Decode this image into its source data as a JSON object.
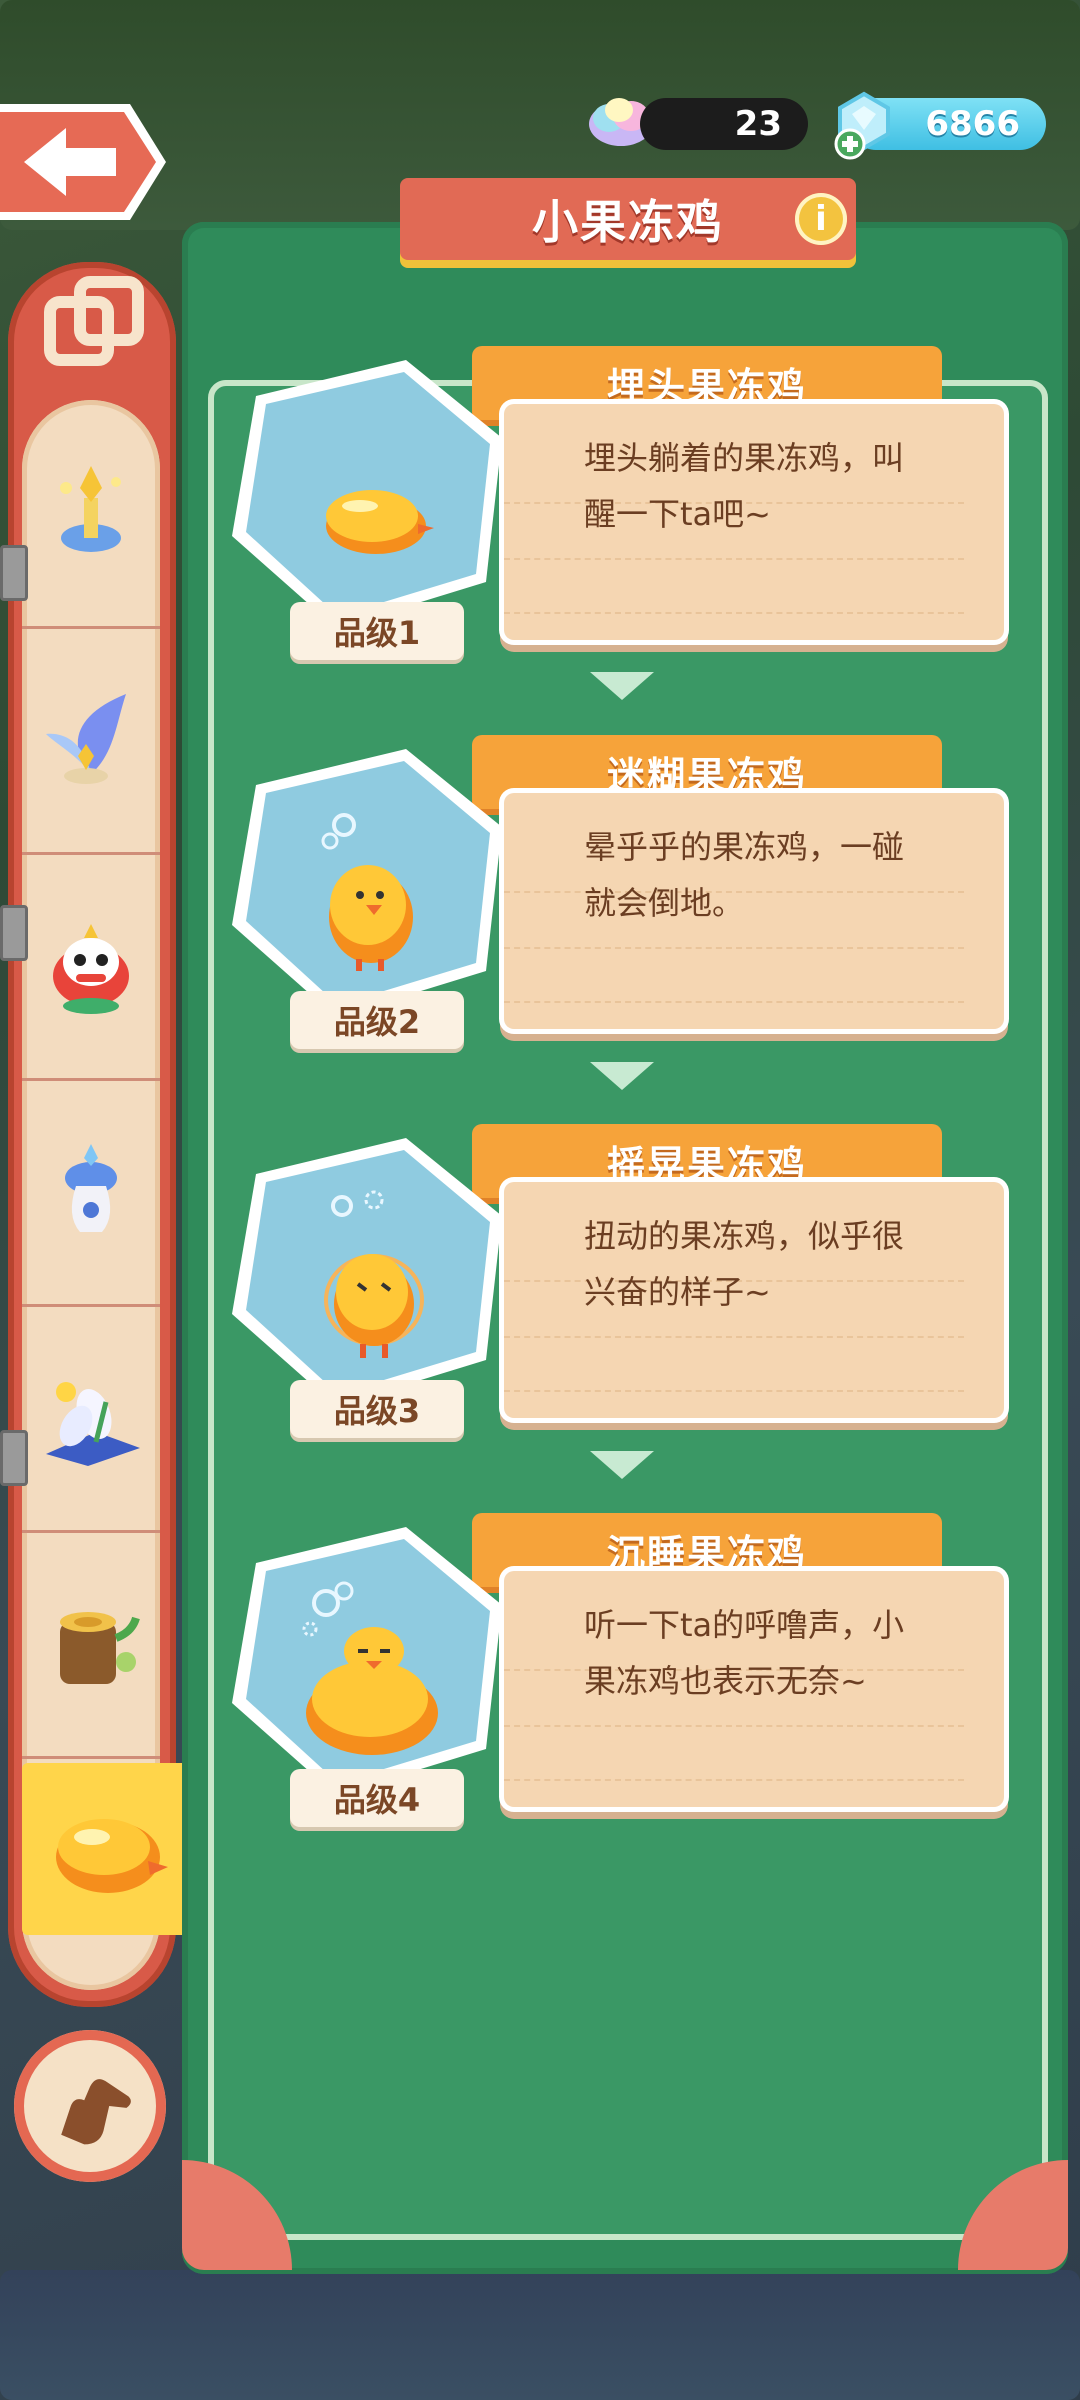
{
  "currency": {
    "jelly_count": "23",
    "gem_count": "6866",
    "jelly_icon": "rainbow-cloud-icon",
    "gem_icon": "diamond-plus-icon"
  },
  "header": {
    "title": "小果冻鸡",
    "info_icon": "i"
  },
  "sidebar": {
    "items": [
      {
        "icon": "trophy-fountain-icon"
      },
      {
        "icon": "crystal-wing-icon"
      },
      {
        "icon": "lion-dance-icon"
      },
      {
        "icon": "porcelain-vase-icon"
      },
      {
        "icon": "lily-flower-icon"
      },
      {
        "icon": "tree-stump-icon"
      },
      {
        "icon": "jelly-chick-icon",
        "selected": true
      }
    ]
  },
  "stages": [
    {
      "name": "埋头果冻鸡",
      "desc_l1": "埋头躺着的果冻鸡，叫",
      "desc_l2": "醒一下ta吧~",
      "grade": "品级1"
    },
    {
      "name": "迷糊果冻鸡",
      "desc_l1": "晕乎乎的果冻鸡，一碰",
      "desc_l2": "就会倒地。",
      "grade": "品级2"
    },
    {
      "name": "摇晃果冻鸡",
      "desc_l1": "扭动的果冻鸡，似乎很",
      "desc_l2": "兴奋的样子~",
      "grade": "品级3"
    },
    {
      "name": "沉睡果冻鸡",
      "desc_l1": "听一下ta的呼噜声，小",
      "desc_l2": "果冻鸡也表示无奈~",
      "grade": "品级4"
    }
  ],
  "colors": {
    "panel_green": "#3a9865",
    "banner_red": "#e16a55",
    "stage_orange": "#f6a33a",
    "card_beige": "#f5d6b2",
    "hex_blue": "#8fcbe0"
  }
}
